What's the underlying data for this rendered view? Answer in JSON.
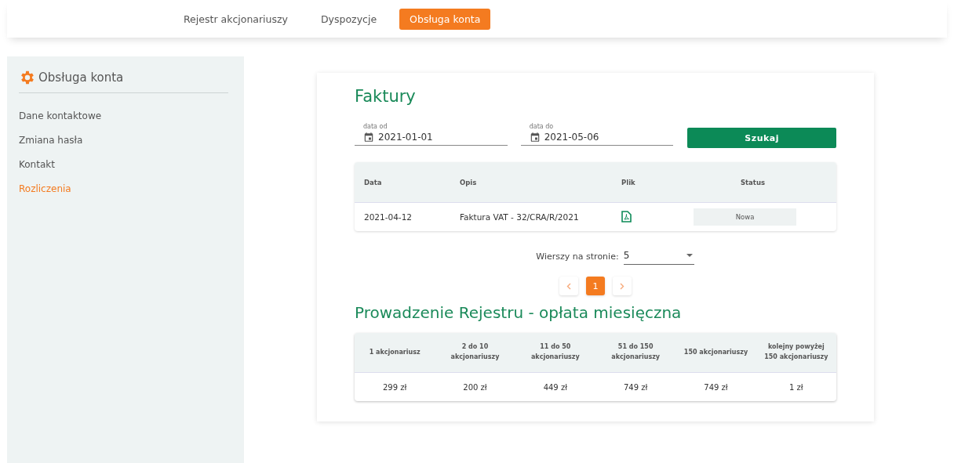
{
  "nav": {
    "items": [
      {
        "label": "Rejestr akcjonariuszy",
        "selected": false
      },
      {
        "label": "Dyspozycje",
        "selected": false
      },
      {
        "label": "Obsługa konta",
        "selected": true
      }
    ]
  },
  "sidebar": {
    "title": "Obsługa konta",
    "items": [
      {
        "label": "Dane kontaktowe",
        "selected": false
      },
      {
        "label": "Zmiana hasła",
        "selected": false
      },
      {
        "label": "Kontakt",
        "selected": false
      },
      {
        "label": "Rozliczenia",
        "selected": true
      }
    ]
  },
  "invoices": {
    "title": "Faktury",
    "filters": [
      {
        "label": "data od",
        "value": "2021-01-01"
      },
      {
        "label": "data do",
        "value": "2021-05-06"
      }
    ],
    "search_button": "Szukaj",
    "table": {
      "columns": [
        "Data",
        "Opis",
        "Plik",
        "Status"
      ],
      "rows": [
        {
          "date": "2021-04-12",
          "description": "Faktura VAT - 32/CRA/R/2021",
          "status": "Nowa"
        }
      ]
    },
    "rows_per_page": {
      "label": "Wierszy na stronie:",
      "value": "5"
    },
    "pages": [
      {
        "label": "1",
        "selected": true
      }
    ]
  },
  "fees": {
    "title": "Prowadzenie Rejestru - opłata miesięczna",
    "columns": [
      "1 akcjonariusz",
      "2 do 10 akcjonariuszy",
      "11 do 50 akcjonariuszy",
      "51 do 150 akcjonariuszy",
      "150 akcjonariuszy",
      "kolejny powyżej 150 akcjonariuszy"
    ],
    "rows": [
      [
        "299 zł",
        "200 zł",
        "449 zł",
        "749 zł",
        "749 zł",
        "1 zł"
      ]
    ]
  }
}
